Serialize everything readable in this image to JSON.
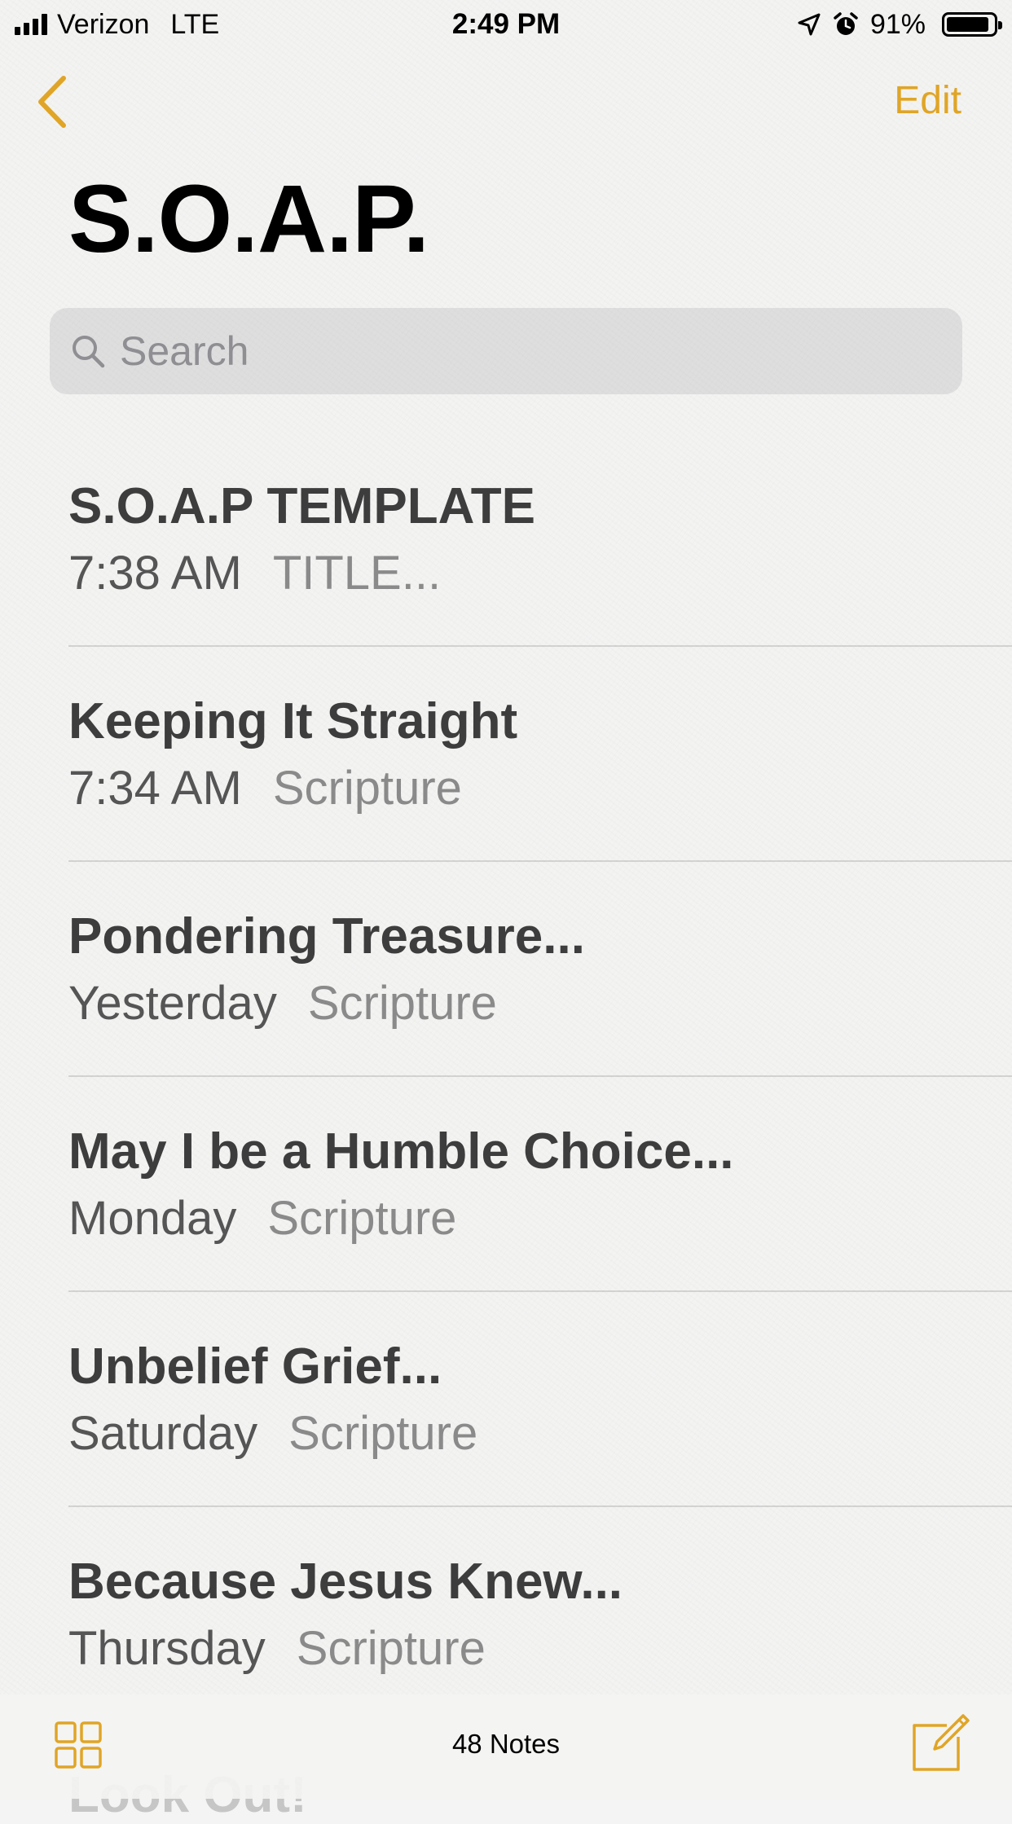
{
  "status_bar": {
    "carrier": "Verizon",
    "network": "LTE",
    "time": "2:49 PM",
    "battery_text": "91%",
    "battery_level": 0.91,
    "icons": [
      "location-arrow-icon",
      "alarm-icon",
      "battery-icon",
      "signal-bars-icon"
    ]
  },
  "nav": {
    "back_icon": "chevron-left-icon",
    "edit_label": "Edit"
  },
  "header": {
    "title": "S.O.A.P."
  },
  "search": {
    "placeholder": "Search",
    "value": ""
  },
  "notes": [
    {
      "title": "S.O.A.P TEMPLATE",
      "date": "7:38 AM",
      "preview": "TITLE..."
    },
    {
      "title": "Keeping It Straight",
      "date": "7:34 AM",
      "preview": "Scripture"
    },
    {
      "title": "Pondering Treasure...",
      "date": "Yesterday",
      "preview": "Scripture"
    },
    {
      "title": "May I be a Humble Choice...",
      "date": "Monday",
      "preview": "Scripture"
    },
    {
      "title": "Unbelief Grief...",
      "date": "Saturday",
      "preview": "Scripture"
    },
    {
      "title": "Because Jesus Knew...",
      "date": "Thursday",
      "preview": "Scripture"
    }
  ],
  "peek_note": {
    "title": "Look Out!"
  },
  "toolbar": {
    "count_label": "48 Notes",
    "gallery_icon": "gallery-view-icon",
    "compose_icon": "compose-icon"
  },
  "colors": {
    "accent": "#e0a526",
    "background": "#f3f3f2",
    "title_text": "#3d3d3d",
    "preview_text": "#8a8a8a"
  }
}
